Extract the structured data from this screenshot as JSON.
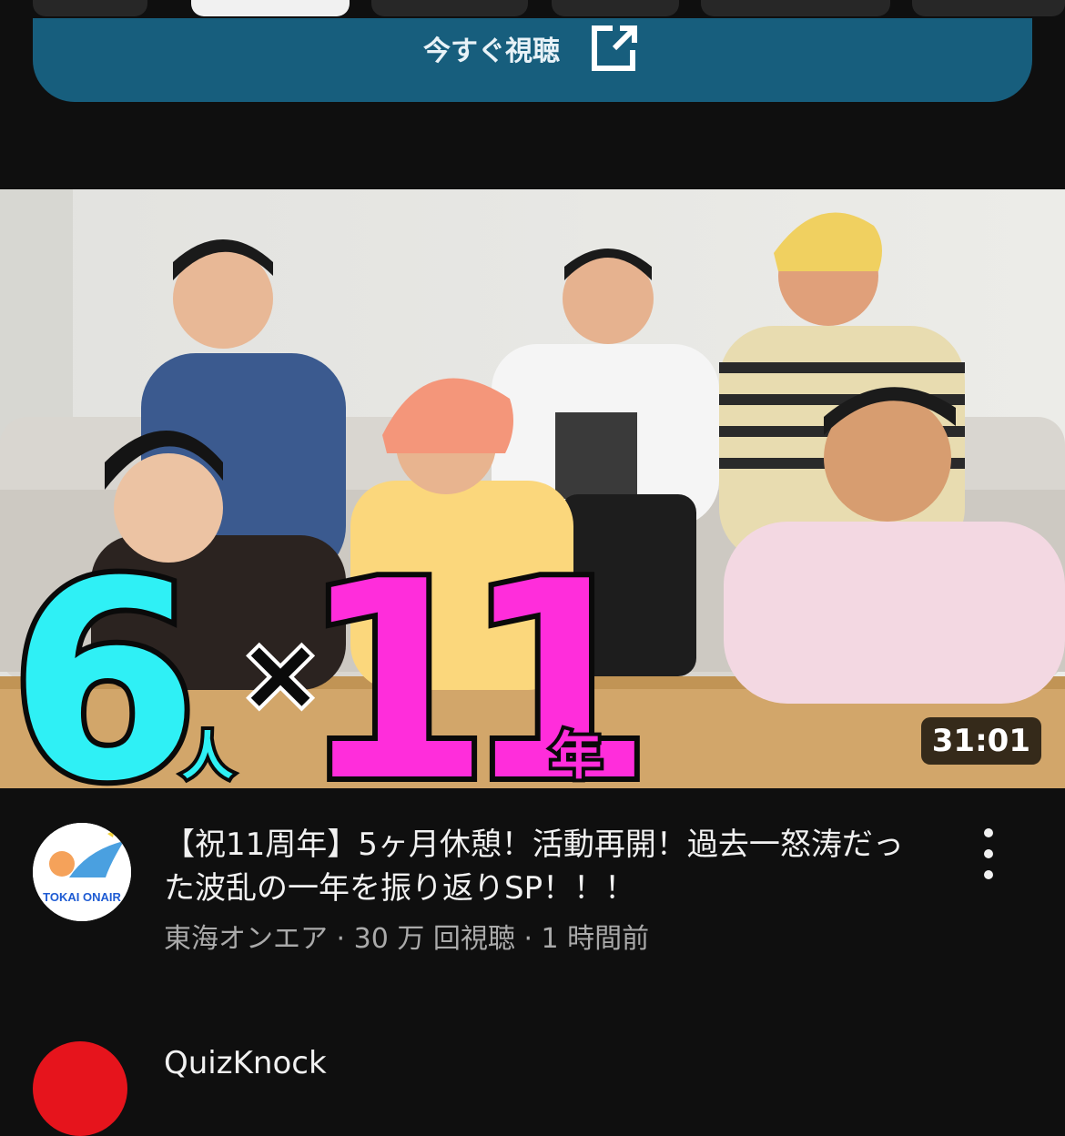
{
  "tabs": [
    "",
    "",
    "",
    "",
    "",
    ""
  ],
  "watch_button": {
    "label": "今すぐ視聴",
    "icon": "external-link-icon",
    "color": "#175e7d"
  },
  "video": {
    "thumbnail_text": {
      "count": "6",
      "count_unit": "人",
      "times": "×",
      "years": "11",
      "years_unit": "年"
    },
    "duration": "31:01",
    "title": "【祝11周年】5ヶ月休憩！活動再開！過去一怒涛だった波乱の一年を振り返りSP！！！",
    "channel_logo_text": "TOKAI ONAIR",
    "channel": "東海オンエア",
    "separator": "·",
    "views": "30 万 回視聴",
    "age": "1 時間前"
  },
  "next_item": {
    "channel": "QuizKnock"
  },
  "colors": {
    "background": "#0f0f0f",
    "secondary_text": "#aaaaaa",
    "thumb_cyan": "#2ff0f5",
    "thumb_magenta": "#ff2ddb"
  }
}
